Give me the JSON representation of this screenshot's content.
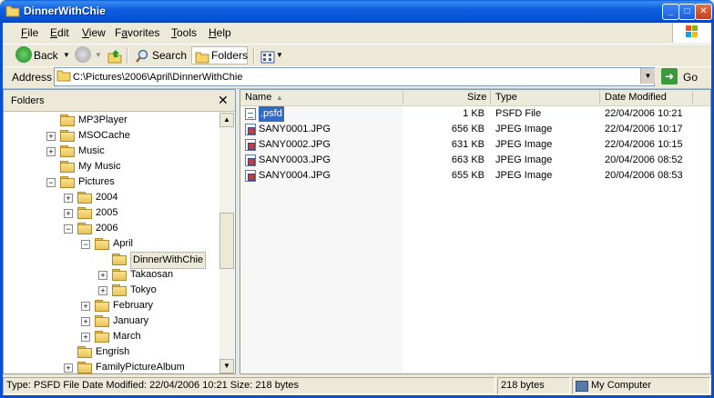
{
  "window": {
    "title": "DinnerWithChie"
  },
  "menu": [
    {
      "label": "File",
      "u": "F",
      "rest": "ile"
    },
    {
      "label": "Edit",
      "u": "E",
      "rest": "dit"
    },
    {
      "label": "View",
      "u": "V",
      "rest": "iew"
    },
    {
      "label": "Favorites",
      "u": "F",
      "rest": "avorites",
      "pre": "",
      "underline_index": 1
    },
    {
      "label": "Tools",
      "u": "T",
      "rest": "ools"
    },
    {
      "label": "Help",
      "u": "H",
      "rest": "elp"
    }
  ],
  "toolbar": {
    "back": "Back",
    "search": "Search",
    "folders": "Folders"
  },
  "address": {
    "label": "Address",
    "value": "C:\\Pictures\\2006\\April\\DinnerWithChie",
    "go": "Go"
  },
  "folders_pane": {
    "title": "Folders",
    "items": [
      {
        "label": "MP3Player",
        "depth": 0,
        "pm": ""
      },
      {
        "label": "MSOCache",
        "depth": 0,
        "pm": "+"
      },
      {
        "label": "Music",
        "depth": 0,
        "pm": "+"
      },
      {
        "label": "My Music",
        "depth": 0,
        "pm": ""
      },
      {
        "label": "Pictures",
        "depth": 0,
        "pm": "-"
      },
      {
        "label": "2004",
        "depth": 1,
        "pm": "+"
      },
      {
        "label": "2005",
        "depth": 1,
        "pm": "+"
      },
      {
        "label": "2006",
        "depth": 1,
        "pm": "-"
      },
      {
        "label": "April",
        "depth": 2,
        "pm": "-"
      },
      {
        "label": "DinnerWithChie",
        "depth": 3,
        "pm": "",
        "selected": true
      },
      {
        "label": "Takaosan",
        "depth": 3,
        "pm": "+"
      },
      {
        "label": "Tokyo",
        "depth": 3,
        "pm": "+"
      },
      {
        "label": "February",
        "depth": 2,
        "pm": "+"
      },
      {
        "label": "January",
        "depth": 2,
        "pm": "+"
      },
      {
        "label": "March",
        "depth": 2,
        "pm": "+"
      },
      {
        "label": "Engrish",
        "depth": 1,
        "pm": ""
      },
      {
        "label": "FamilyPictureAlbum",
        "depth": 1,
        "pm": "+"
      }
    ]
  },
  "list": {
    "columns": {
      "name": "Name",
      "size": "Size",
      "type": "Type",
      "modified": "Date Modified"
    },
    "rows": [
      {
        "name": ".psfd",
        "size": "1 KB",
        "type": "PSFD File",
        "modified": "22/04/2006 10:21",
        "kind": "psfd",
        "selected": true
      },
      {
        "name": "SANY0001.JPG",
        "size": "656 KB",
        "type": "JPEG Image",
        "modified": "22/04/2006 10:17",
        "kind": "jpg"
      },
      {
        "name": "SANY0002.JPG",
        "size": "631 KB",
        "type": "JPEG Image",
        "modified": "22/04/2006 10:15",
        "kind": "jpg"
      },
      {
        "name": "SANY0003.JPG",
        "size": "663 KB",
        "type": "JPEG Image",
        "modified": "20/04/2006 08:52",
        "kind": "jpg"
      },
      {
        "name": "SANY0004.JPG",
        "size": "655 KB",
        "type": "JPEG Image",
        "modified": "20/04/2006 08:53",
        "kind": "jpg"
      }
    ]
  },
  "status": {
    "info": "Type: PSFD File Date Modified: 22/04/2006 10:21 Size: 218 bytes",
    "size": "218 bytes",
    "zone": "My Computer"
  }
}
